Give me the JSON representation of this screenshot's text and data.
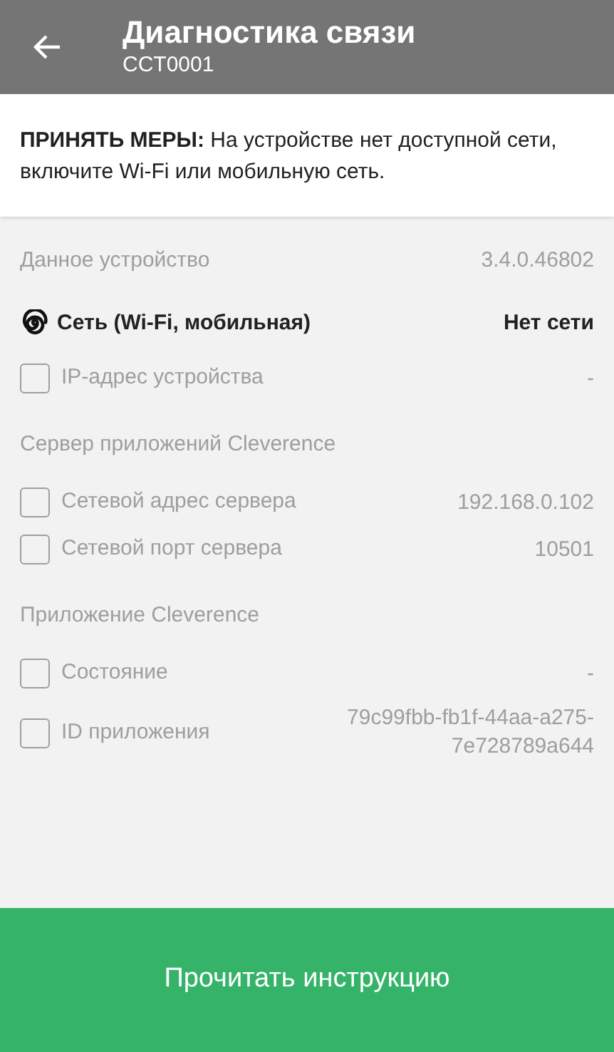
{
  "header": {
    "title": "Диагностика связи",
    "subtitle": "CCT0001"
  },
  "notice": "**ПРИНЯТЬ МЕРЫ:** На устройстве нет доступной сети, включите Wi-Fi или мобильную сеть.",
  "rows": [
    {
      "kind": "info",
      "label": "Данное устройство",
      "value": "3.4.0.46802"
    },
    {
      "kind": "network",
      "label": "Сеть (Wi-Fi, мобильная)",
      "value": "Нет сети"
    },
    {
      "kind": "check",
      "label": "IP-адрес устройства",
      "value": "-",
      "checked": false
    },
    {
      "kind": "section",
      "label": "Сервер приложений Cleverence"
    },
    {
      "kind": "check",
      "label": "Сетевой адрес сервера",
      "value": "192.168.0.102",
      "checked": false
    },
    {
      "kind": "check",
      "label": "Сетевой порт сервера",
      "value": "10501",
      "checked": false
    },
    {
      "kind": "section",
      "label": "Приложение Cleverence"
    },
    {
      "kind": "check",
      "label": "Состояние",
      "value": "-",
      "checked": false
    },
    {
      "kind": "check",
      "label": "ID приложения",
      "value": "79c99fbb-fb1f-44aa-a275-7e728789a644",
      "checked": false
    }
  ],
  "button": "Прочитать инструкцию"
}
